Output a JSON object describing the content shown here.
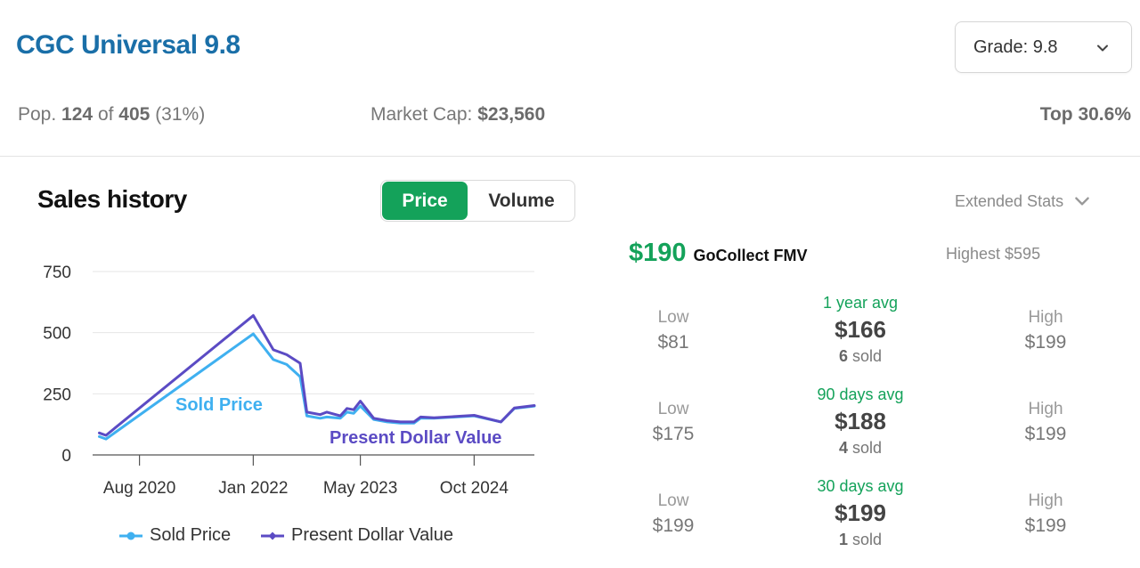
{
  "header": {
    "title": "CGC Universal 9.8",
    "grade_select": "Grade: 9.8"
  },
  "stats": {
    "pop_prefix": "Pop.",
    "pop_count": "124",
    "pop_of": "of",
    "pop_total": "405",
    "pop_pct": "(31%)",
    "market_cap_label": "Market Cap:",
    "market_cap_value": "$23,560",
    "top_pct": "Top 30.6%"
  },
  "sales": {
    "title": "Sales history",
    "toggle_price": "Price",
    "toggle_volume": "Volume",
    "extended_stats": "Extended Stats",
    "fmv_value": "$190",
    "fmv_label": "GoCollect FMV",
    "highest": "Highest $595",
    "blocks": [
      {
        "low_label": "Low",
        "low_value": "$81",
        "avg_label": "1 year avg",
        "avg_value": "$166",
        "sold_count": "6",
        "sold_word": "sold",
        "high_label": "High",
        "high_value": "$199"
      },
      {
        "low_label": "Low",
        "low_value": "$175",
        "avg_label": "90 days avg",
        "avg_value": "$188",
        "sold_count": "4",
        "sold_word": "sold",
        "high_label": "High",
        "high_value": "$199"
      },
      {
        "low_label": "Low",
        "low_value": "$199",
        "avg_label": "30 days avg",
        "avg_value": "$199",
        "sold_count": "1",
        "sold_word": "sold",
        "high_label": "High",
        "high_value": "$199"
      }
    ]
  },
  "chart_data": {
    "type": "line",
    "y_ticks": [
      "750",
      "500",
      "250",
      "0"
    ],
    "x_ticks": [
      "Aug 2020",
      "Jan 2022",
      "May 2023",
      "Oct 2024"
    ],
    "ylim": [
      0,
      750
    ],
    "xlim": [
      "2020-01",
      "2025-07"
    ],
    "grid": true,
    "legend_position": "bottom",
    "series": [
      {
        "name": "Sold Price",
        "color": "#3fb0f0",
        "x": [
          "2020-02",
          "2020-03",
          "2022-01",
          "2022-04",
          "2022-06",
          "2022-08",
          "2022-09",
          "2022-11",
          "2022-12",
          "2023-02",
          "2023-03",
          "2023-04",
          "2023-05",
          "2023-07",
          "2023-09",
          "2023-11",
          "2024-01",
          "2024-02",
          "2024-04",
          "2024-10",
          "2025-02",
          "2025-04",
          "2025-07"
        ],
        "y": [
          75,
          65,
          495,
          390,
          370,
          320,
          160,
          150,
          155,
          150,
          175,
          170,
          200,
          145,
          135,
          130,
          130,
          150,
          150,
          160,
          135,
          190,
          200
        ],
        "label": "Sold Price"
      },
      {
        "name": "Present Dollar Value",
        "color": "#5b4bc4",
        "x": [
          "2020-02",
          "2020-03",
          "2022-01",
          "2022-04",
          "2022-06",
          "2022-08",
          "2022-09",
          "2022-11",
          "2022-12",
          "2023-02",
          "2023-03",
          "2023-04",
          "2023-05",
          "2023-07",
          "2023-09",
          "2023-11",
          "2024-01",
          "2024-02",
          "2024-04",
          "2024-10",
          "2025-02",
          "2025-04",
          "2025-07"
        ],
        "y": [
          90,
          80,
          570,
          430,
          410,
          375,
          175,
          165,
          175,
          160,
          190,
          185,
          220,
          150,
          140,
          135,
          135,
          155,
          152,
          162,
          135,
          192,
          202
        ],
        "label": "Present Dollar Value"
      }
    ]
  }
}
